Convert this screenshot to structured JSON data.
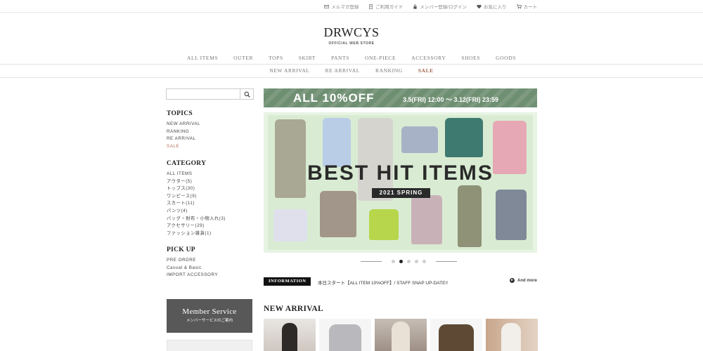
{
  "utility_links": [
    {
      "icon": "mail-icon",
      "label": "メルマガ登録"
    },
    {
      "icon": "document-icon",
      "label": "ご利用ガイド"
    },
    {
      "icon": "lock-icon",
      "label": "メンバー登録/ログイン"
    },
    {
      "icon": "heart-icon",
      "label": "お気に入り"
    },
    {
      "icon": "cart-icon",
      "label": "カート"
    }
  ],
  "logo": {
    "name": "DRWCYS",
    "sub": "OFFICIAL WEB STORE"
  },
  "nav_primary": [
    "ALL ITEMS",
    "OUTER",
    "TOPS",
    "SKIRT",
    "PANTS",
    "ONE-PIECE",
    "ACCESSORY",
    "SHOES",
    "GOODS"
  ],
  "nav_secondary": [
    "NEW ARRIVAL",
    "RE ARRIVAL",
    "RANKING",
    "SALE"
  ],
  "search": {
    "placeholder": ""
  },
  "topics": {
    "title": "TOPICS",
    "items": [
      "NEW ARRIVAL",
      "RANKING",
      "RE ARRIVAL",
      "SALE"
    ]
  },
  "category": {
    "title": "CATEGORY",
    "items": [
      "ALL ITEMS",
      "アウター(5)",
      "トップス(30)",
      "ワンピース(9)",
      "スカート(11)",
      "パンツ(4)",
      "バッグ・財布・小物入れ(3)",
      "アクセサリー(29)",
      "ファッション雑貨(1)"
    ]
  },
  "pickup": {
    "title": "PICK UP",
    "items": [
      "PRE ORDRE",
      "Casual & Basic",
      "IMPORT ACCESSORY"
    ]
  },
  "member": {
    "title": "Member Service",
    "sub": "メンバーサービスのご案内"
  },
  "promo": {
    "headline": "ALL 10%OFF",
    "dates": "3.5(FRI) 12:00 〜 3.12(FRI) 23:59",
    "color": "#6f8f72"
  },
  "hero": {
    "headline": "BEST HIT ITEMS",
    "season": "2021 SPRING"
  },
  "carousel": {
    "count": 5,
    "active": 1
  },
  "information": {
    "badge": "INFORMATION",
    "text": "本日スタート【ALL ITEM 10%OFF】/ STAFF SNAP UP-DATE!!",
    "more": "And more"
  },
  "new_arrival": {
    "title": "NEW ARRIVAL"
  }
}
